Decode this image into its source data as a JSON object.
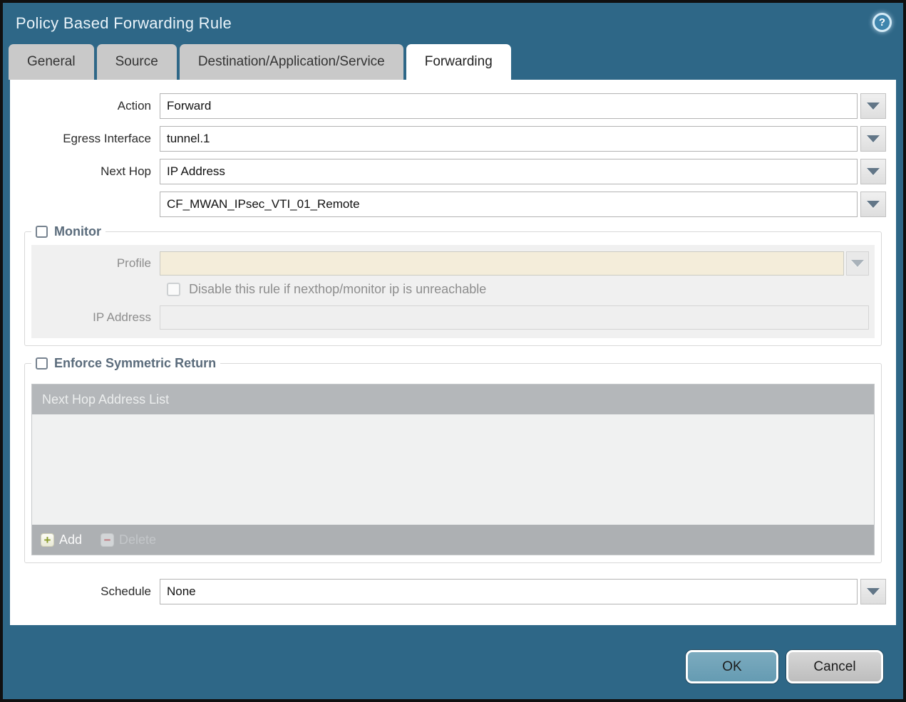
{
  "window": {
    "title": "Policy Based Forwarding Rule",
    "help_icon": "?"
  },
  "tabs": [
    {
      "label": "General",
      "active": false
    },
    {
      "label": "Source",
      "active": false
    },
    {
      "label": "Destination/Application/Service",
      "active": false
    },
    {
      "label": "Forwarding",
      "active": true
    }
  ],
  "form": {
    "action": {
      "label": "Action",
      "value": "Forward"
    },
    "egress_interface": {
      "label": "Egress Interface",
      "value": "tunnel.1"
    },
    "next_hop": {
      "label": "Next Hop",
      "value": "IP Address"
    },
    "next_hop_address": {
      "value": "CF_MWAN_IPsec_VTI_01_Remote"
    },
    "schedule": {
      "label": "Schedule",
      "value": "None"
    }
  },
  "monitor": {
    "legend": "Monitor",
    "checked": false,
    "profile_label": "Profile",
    "profile_value": "",
    "disable_checkbox_label": "Disable this rule if nexthop/monitor ip is unreachable",
    "disable_checkbox_checked": false,
    "ip_address_label": "IP Address",
    "ip_address_value": ""
  },
  "symmetric_return": {
    "legend": "Enforce Symmetric Return",
    "checked": false,
    "table_header": "Next Hop Address List",
    "rows": [],
    "add_label": "Add",
    "delete_label": "Delete",
    "delete_enabled": false
  },
  "footer": {
    "ok_label": "OK",
    "cancel_label": "Cancel"
  },
  "colors": {
    "chrome_teal": "#2e6787",
    "active_tab": "#ffffff",
    "inactive_tab": "#c9c9c9",
    "legend_text": "#5a6b7b",
    "profile_field_bg": "#f4edda",
    "table_header_bg": "#b4b7ba",
    "table_footer_bg": "#adb0b3",
    "add_plus": "#8a9c2e",
    "delete_minus": "#c0767c",
    "ok_button": "#6ea0b6",
    "cancel_button": "#c9c9c9"
  }
}
